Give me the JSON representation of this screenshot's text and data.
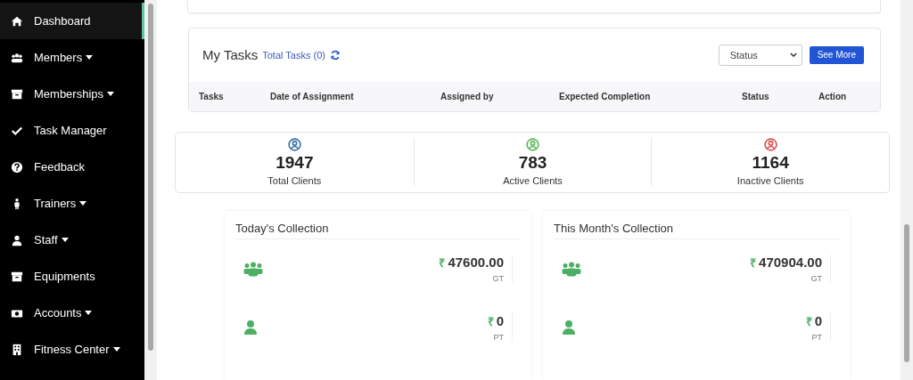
{
  "sidebar": {
    "items": [
      {
        "label": "Dashboard",
        "selected": true,
        "has_menu": false
      },
      {
        "label": "Members",
        "selected": false,
        "has_menu": true
      },
      {
        "label": "Memberships",
        "selected": false,
        "has_menu": true
      },
      {
        "label": "Task Manager",
        "selected": false,
        "has_menu": false
      },
      {
        "label": "Feedback",
        "selected": false,
        "has_menu": false
      },
      {
        "label": "Trainers",
        "selected": false,
        "has_menu": true
      },
      {
        "label": "Staff",
        "selected": false,
        "has_menu": true
      },
      {
        "label": "Equipments",
        "selected": false,
        "has_menu": false
      },
      {
        "label": "Accounts",
        "selected": false,
        "has_menu": true
      },
      {
        "label": "Fitness Center",
        "selected": false,
        "has_menu": true
      }
    ]
  },
  "tasks": {
    "title": "My Tasks",
    "total": "Total Tasks (0)",
    "status_select": "Status",
    "see_more": "See More",
    "columns": [
      "Tasks",
      "Date of Assignment",
      "Assigned by",
      "Expected Completion",
      "Status",
      "Action"
    ]
  },
  "client_stats": [
    {
      "value": "1947",
      "label": "Total Clients",
      "color": "#3b6ea5"
    },
    {
      "value": "783",
      "label": "Active Clients",
      "color": "#5cb85c"
    },
    {
      "value": "1164",
      "label": "Inactive Clients",
      "color": "#d9534f"
    }
  ],
  "collections": [
    {
      "title": "Today's Collection",
      "rows": [
        {
          "kind": "group",
          "currency": "₹",
          "amount": "47600.00",
          "label": "GT"
        },
        {
          "kind": "single",
          "currency": "₹",
          "amount": "0",
          "label": "PT"
        }
      ]
    },
    {
      "title": "This Month's Collection",
      "rows": [
        {
          "kind": "group",
          "currency": "₹",
          "amount": "470904.00",
          "label": "GT"
        },
        {
          "kind": "single",
          "currency": "₹",
          "amount": "0",
          "label": "PT"
        }
      ]
    }
  ]
}
